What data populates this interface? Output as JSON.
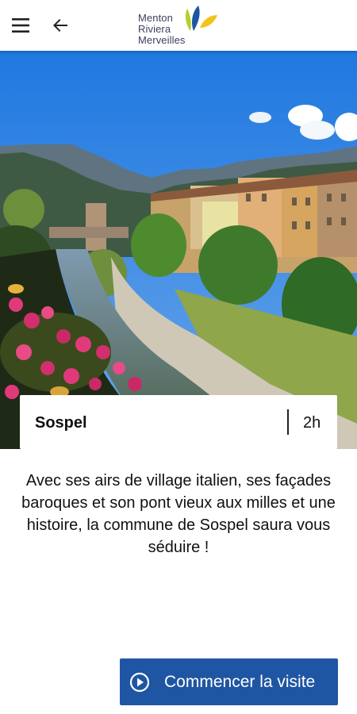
{
  "header": {
    "logo": {
      "lines": [
        "Menton",
        "Riviera",
        "Merveilles"
      ],
      "colors": {
        "blue": "#1f56a3",
        "yellow": "#f2c418",
        "green": "#b6cf2b"
      }
    },
    "icons": {
      "menu": "menu-icon",
      "back": "arrow-left-icon"
    }
  },
  "hero": {
    "image": "Sospel village river scene"
  },
  "place": {
    "name": "Sospel",
    "duration": "2h"
  },
  "description": "Avec ses airs de village italien, ses façades baroques et son pont vieux aux milles et une histoire, la commune de Sospel saura vous séduire !",
  "cta": {
    "label": "Commencer la visite",
    "icon": "play-circle-icon",
    "color": "#1f56a3"
  }
}
